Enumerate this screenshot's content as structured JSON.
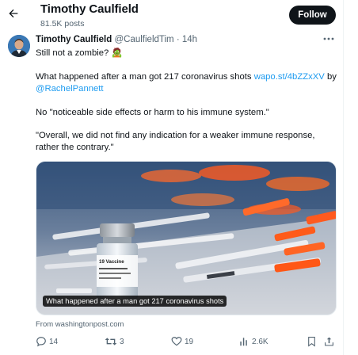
{
  "header": {
    "name": "Timothy Caulfield",
    "posts": "81.5K posts",
    "follow_label": "Follow",
    "back_icon": "arrow-left-icon"
  },
  "tweet": {
    "author_name": "Timothy Caulfield",
    "handle": "@CaulfieldTim",
    "separator": "·",
    "time": "14h",
    "line1": "Still not a zombie? 🧟",
    "line2_text": "What happened after a man got 217 coronavirus shots ",
    "line2_link": "wapo.st/4bZZxXV",
    "line2_by": " by",
    "mention": "@RachelPannett",
    "line3": "No \"noticeable side effects or harm to his immune system.\"",
    "line4a": "\"Overall, we did not find any indication for a weaker immune response,",
    "line4b": "rather the contrary.\"",
    "media_caption": "What happened after a man got 217 coronavirus shots",
    "vial_label": "19 Vaccine",
    "source": "From washingtonpost.com"
  },
  "actions": {
    "replies": "14",
    "reposts": "3",
    "likes": "19",
    "views": "2.6K"
  },
  "colors": {
    "link": "#1d9bf0",
    "text": "#0f1419",
    "secondary": "#536471",
    "follow_bg": "#0f1419"
  }
}
